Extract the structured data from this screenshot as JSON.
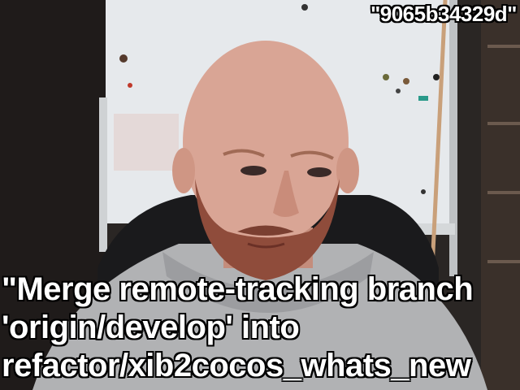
{
  "overlay": {
    "commit_hash": "\"9065b34329d\"",
    "message_lines": [
      "\"Merge remote-tracking branch",
      "'origin/develop' into",
      "refactor/xib2cocos_whats_new"
    ]
  },
  "colors": {
    "wall": "#2a2624",
    "whiteboard": "#e9ecee",
    "skin": "#d8a292",
    "beard": "#8a4a3a",
    "hoodie": "#b3b4b6",
    "text": "#ffffff",
    "text_outline": "#000000"
  }
}
